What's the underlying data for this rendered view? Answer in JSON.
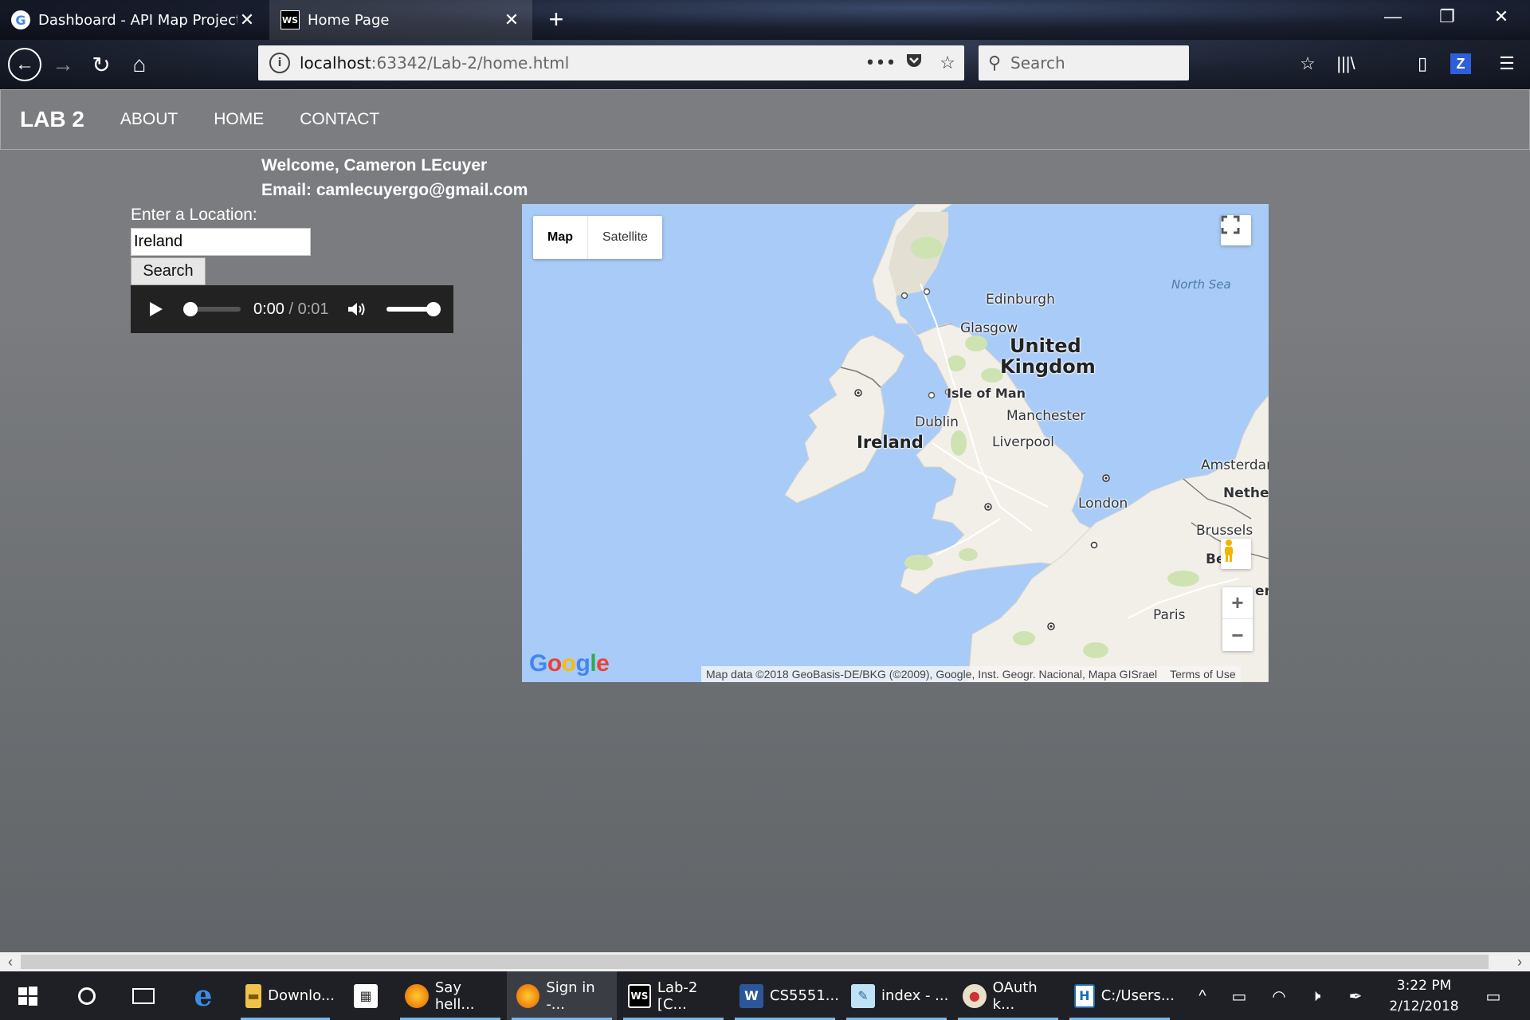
{
  "browser": {
    "tabs": [
      {
        "title": "Dashboard - API Map Project",
        "favicon": "google-icon",
        "active": false
      },
      {
        "title": "Home Page",
        "favicon": "webstorm-icon",
        "active": true
      }
    ],
    "url_host": "localhost",
    "url_path": ":63342/Lab-2/home.html",
    "search_placeholder": "Search"
  },
  "site": {
    "brand": "LAB 2",
    "nav_links": [
      "ABOUT",
      "HOME",
      "CONTACT"
    ],
    "welcome": "Welcome, Cameron LEcuyer",
    "email": "Email: camlecuyergo@gmail.com",
    "location_label": "Enter a Location:",
    "location_value": "Ireland",
    "search_button": "Search",
    "audio": {
      "current": "0:00",
      "separator": " / ",
      "duration": "0:01",
      "progress": 0.0,
      "volume": 1.0
    }
  },
  "map": {
    "map_type_buttons": [
      "Map",
      "Satellite"
    ],
    "selected_type": "Map",
    "labels": {
      "north_sea": "North Sea",
      "edinburgh": "Edinburgh",
      "glasgow": "Glasgow",
      "uk_line1": "United",
      "uk_line2": "Kingdom",
      "isle_of_man": "Isle of Man",
      "dublin": "Dublin",
      "ireland": "Ireland",
      "manchester": "Manchester",
      "liverpool": "Liverpool",
      "amsterdam": "Amsterdan",
      "netherlands": "Netherl",
      "london": "London",
      "brussels": "Brussels",
      "belgium": "Be",
      "germany": "en",
      "paris": "Paris"
    },
    "logo_text": "Google",
    "attribution": "Map data ©2018 GeoBasis-DE/BKG (©2009), Google, Inst. Geogr. Nacional, Mapa GISrael",
    "terms": "Terms of Use"
  },
  "taskbar": {
    "apps": [
      {
        "label": "Downlo...",
        "icon": "file-explorer-icon"
      },
      {
        "label": "",
        "icon": "store-icon"
      },
      {
        "label": "Say hell...",
        "icon": "firefox-icon"
      },
      {
        "label": "Sign in -...",
        "icon": "firefox-icon"
      },
      {
        "label": "Lab-2 [C...",
        "icon": "webstorm-icon"
      },
      {
        "label": "CS5551...",
        "icon": "word-icon"
      },
      {
        "label": "index - ...",
        "icon": "notepad-icon"
      },
      {
        "label": "OAuth k...",
        "icon": "paint-icon"
      },
      {
        "label": "C:/Users...",
        "icon": "terminal-icon"
      }
    ],
    "time": "3:22 PM",
    "date": "2/12/2018"
  },
  "colors": {
    "page_background": "#7b7d80",
    "map_water": "#a9cbf7",
    "map_land": "#f2efe9",
    "audio_bg": "#222222",
    "taskbar_bg": "#1f2025",
    "taskbar_accent": "#76b9ed"
  }
}
